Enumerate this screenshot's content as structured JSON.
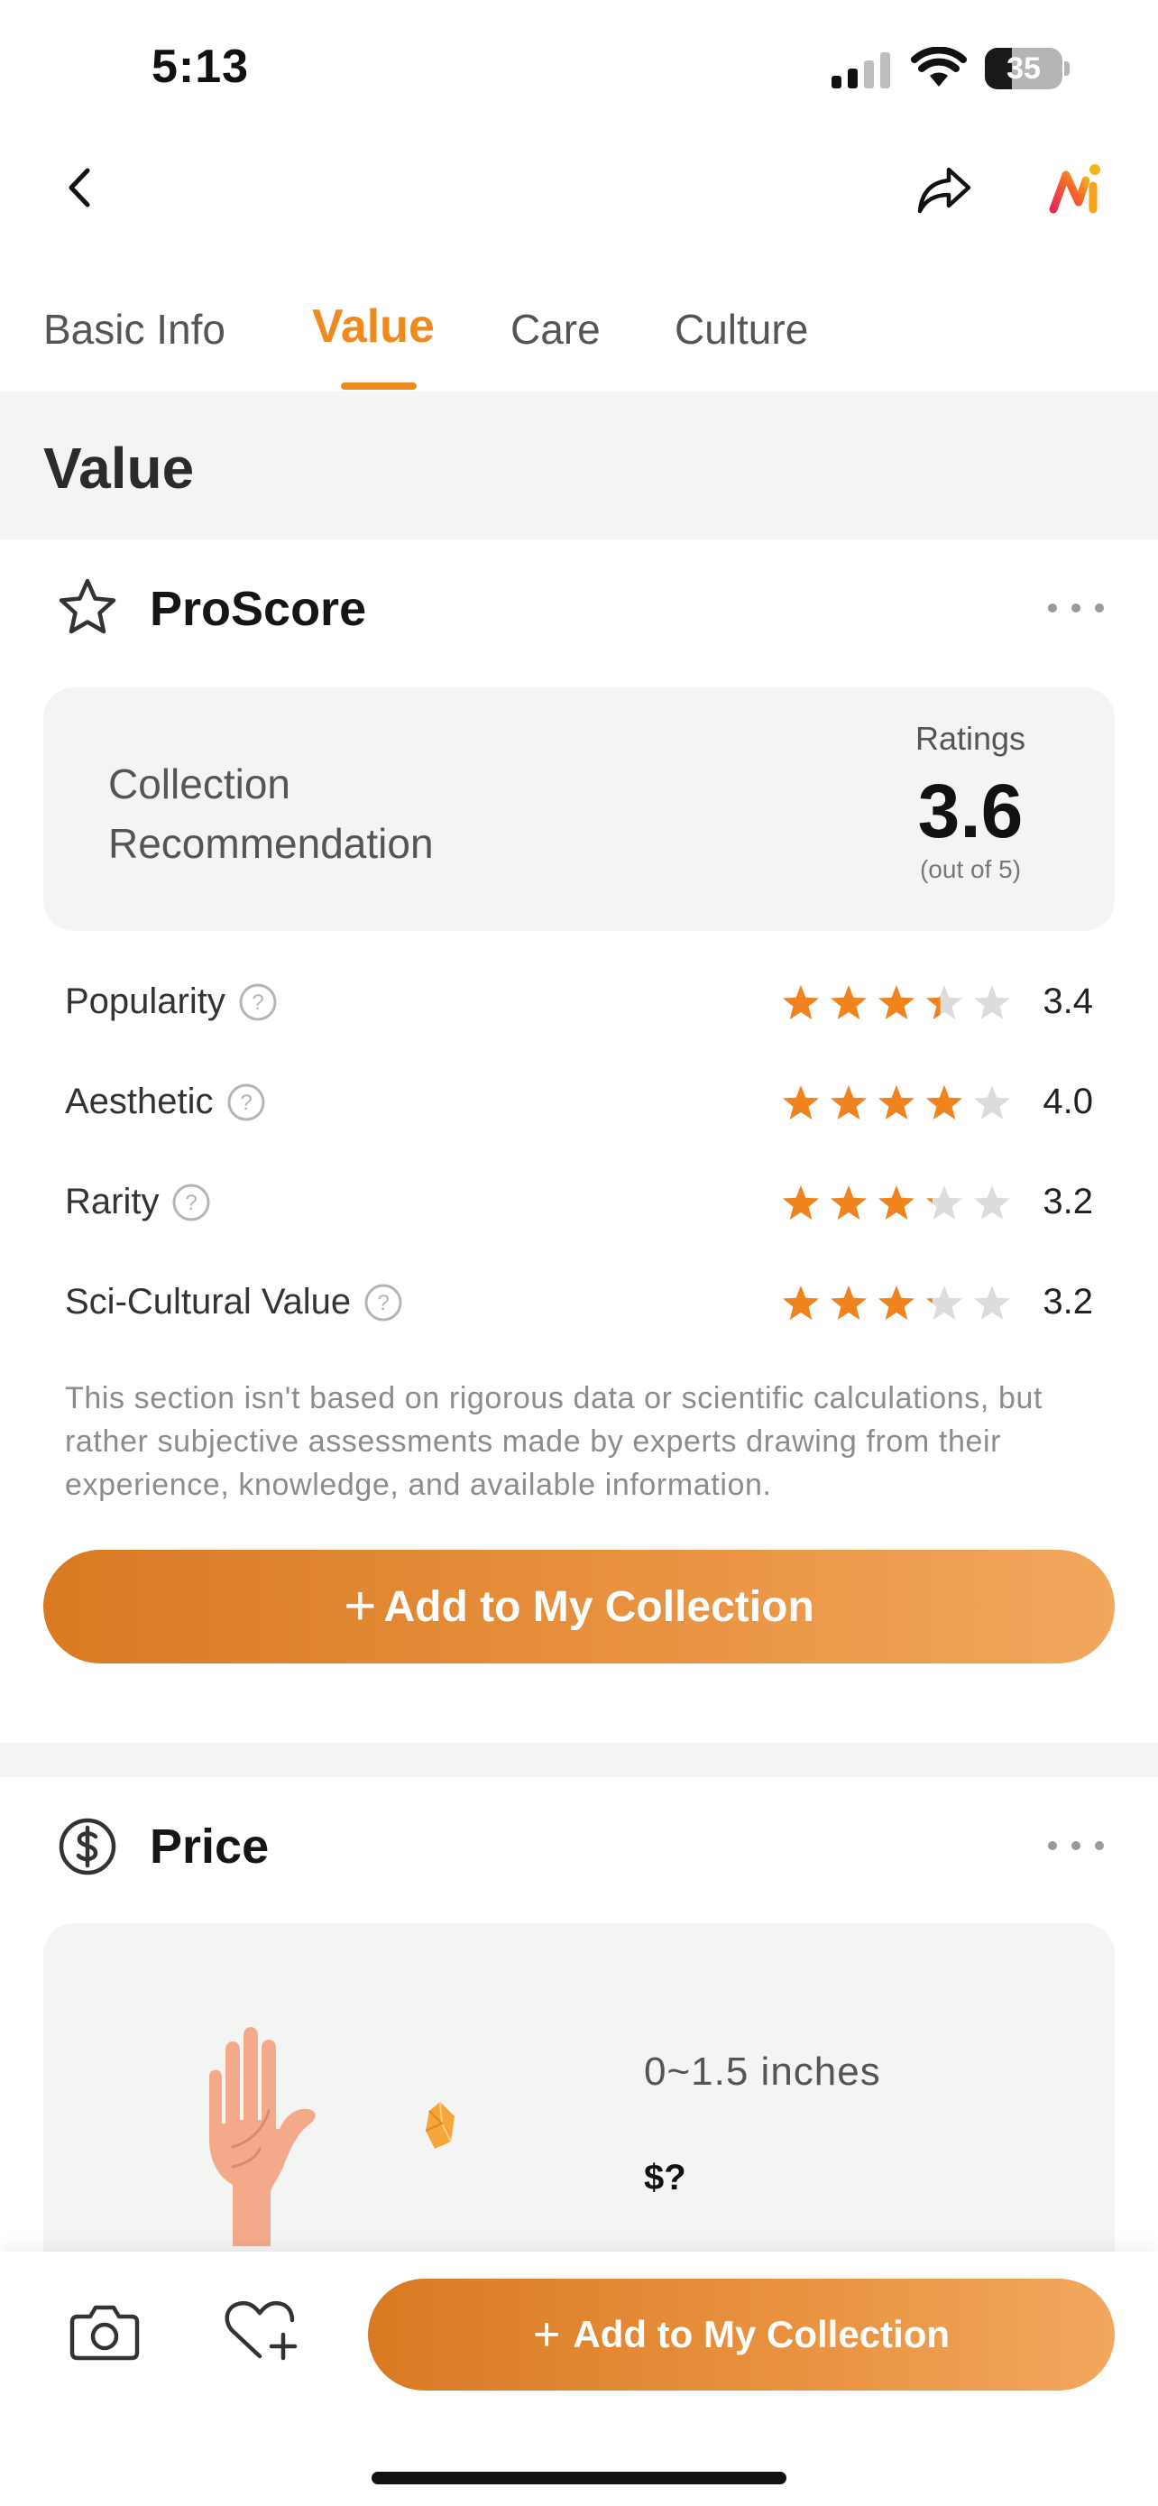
{
  "status_bar": {
    "time": "5:13",
    "battery_percent": "35",
    "battery_level": 0.35
  },
  "nav": {
    "back_icon": "chevron-left-icon",
    "share_icon": "share-icon",
    "logo_icon": "app-logo-icon"
  },
  "tabs": [
    {
      "label": "Basic Info",
      "active": false
    },
    {
      "label": "Value",
      "active": true
    },
    {
      "label": "Care",
      "active": false
    },
    {
      "label": "Culture",
      "active": false
    }
  ],
  "section": {
    "title": "Value"
  },
  "proscore": {
    "title": "ProScore",
    "icon": "star-outline-icon",
    "recommendation_label": "Collection Recommendation",
    "ratings_label": "Ratings",
    "rating": "3.6",
    "out_of": "(out of 5)",
    "metrics": [
      {
        "label": "Popularity",
        "value": "3.4",
        "score": 3.4
      },
      {
        "label": "Aesthetic",
        "value": "4.0",
        "score": 4.0
      },
      {
        "label": "Rarity",
        "value": "3.2",
        "score": 3.2
      },
      {
        "label": "Sci-Cultural Value",
        "value": "3.2",
        "score": 3.2
      }
    ],
    "disclaimer": "This section isn't based on rigorous data or scientific calculations, but rather subjective assessments made by experts drawing from their experience, knowledge, and available information.",
    "cta_label": "Add to My Collection"
  },
  "price": {
    "title": "Price",
    "icon": "dollar-circle-icon",
    "size_label": "0~1.5 inches",
    "price_value": "$?"
  },
  "bottom_bar": {
    "camera_icon": "camera-icon",
    "wishlist_icon": "heart-plus-icon",
    "cta_label": "Add to My Collection"
  },
  "colors": {
    "accent": "#ef8a1f",
    "star_filled": "#f0831e",
    "star_empty": "#dcdcdc",
    "band": "#f4f4f3"
  }
}
